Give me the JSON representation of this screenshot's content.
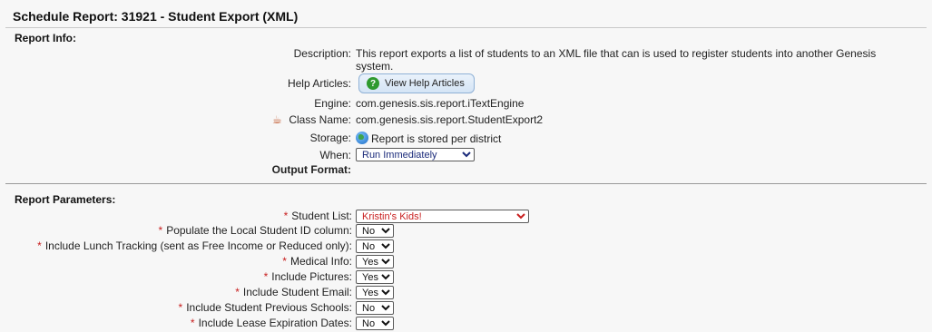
{
  "header": {
    "title": "Schedule Report: 31921 - Student Export (XML)"
  },
  "report_info": {
    "section_label": "Report Info:",
    "description_label": "Description:",
    "description_line1": "This report exports a list of students to an XML file that can is used to register students into another Genesis",
    "description_line2": "system.",
    "help_label": "Help Articles:",
    "help_button": "View Help Articles",
    "engine_label": "Engine:",
    "engine_value": "com.genesis.sis.report.iTextEngine",
    "class_label": "Class Name:",
    "class_value": "com.genesis.sis.report.StudentExport2",
    "storage_label": "Storage:",
    "storage_value": "Report is stored per district",
    "when_label": "When:",
    "when_value": "Run Immediately",
    "output_label": "Output Format:"
  },
  "parameters": {
    "section_label": "Report Parameters:",
    "required_mark": "*",
    "items": [
      {
        "label": "Student List:",
        "value": "Kristin's Kids!"
      },
      {
        "label": "Populate the Local Student ID column:",
        "value": "No"
      },
      {
        "label": "Include Lunch Tracking (sent as Free Income or Reduced only):",
        "value": "No"
      },
      {
        "label": "Medical Info:",
        "value": "Yes"
      },
      {
        "label": "Include Pictures:",
        "value": "Yes"
      },
      {
        "label": "Include Student Email:",
        "value": "Yes"
      },
      {
        "label": "Include Student Previous Schools:",
        "value": "No"
      },
      {
        "label": "Include Lease Expiration Dates:",
        "value": "No"
      }
    ]
  },
  "icons": {
    "help": "help-circle-icon",
    "java": "java-icon",
    "storage": "globe-icon"
  },
  "colors": {
    "required": "#c81e1e",
    "help_icon": "#2f9a2f",
    "student_list_text": "#c81e1e"
  }
}
